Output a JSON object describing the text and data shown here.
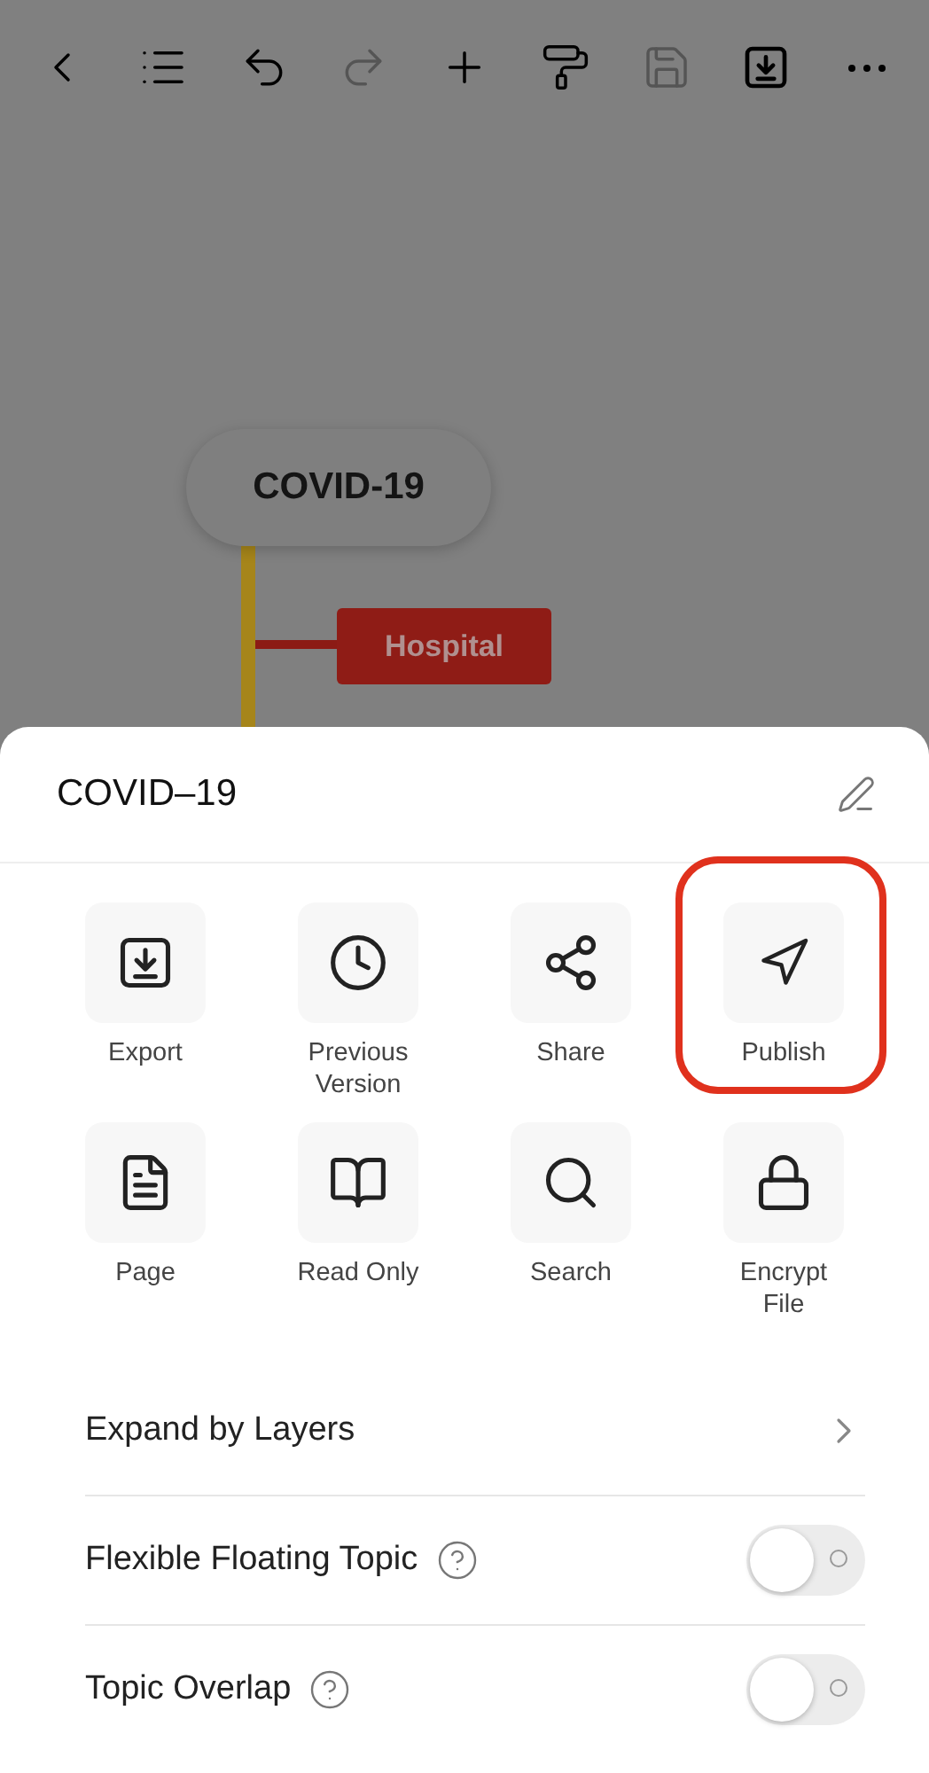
{
  "toolbar": [
    {
      "kind": "back",
      "disabled": false
    },
    {
      "kind": "outline",
      "disabled": false
    },
    {
      "kind": "undo",
      "disabled": false
    },
    {
      "kind": "redo",
      "disabled": true
    },
    {
      "kind": "add",
      "disabled": false
    },
    {
      "kind": "format",
      "disabled": false
    },
    {
      "kind": "save",
      "disabled": true
    },
    {
      "kind": "download",
      "disabled": false
    },
    {
      "kind": "more",
      "disabled": false
    }
  ],
  "mind_map": {
    "central_topic": "COVID-19",
    "topics": [
      {
        "label": "Hospital"
      }
    ]
  },
  "sheet": {
    "title": "COVID–19",
    "actions": [
      {
        "kind": "export",
        "label": "Export",
        "highlighted": false
      },
      {
        "kind": "history",
        "label": "Previous Version",
        "highlighted": false
      },
      {
        "kind": "share",
        "label": "Share",
        "highlighted": false
      },
      {
        "kind": "publish",
        "label": "Publish",
        "highlighted": true
      },
      {
        "kind": "page",
        "label": "Page",
        "highlighted": false
      },
      {
        "kind": "read",
        "label": "Read Only",
        "highlighted": false
      },
      {
        "kind": "search",
        "label": "Search",
        "highlighted": false
      },
      {
        "kind": "encrypt",
        "label": "Encrypt File",
        "highlighted": false
      }
    ],
    "settings": [
      {
        "kind": "link",
        "label": "Expand by Layers"
      },
      {
        "kind": "toggle",
        "label": "Flexible Floating Topic",
        "help": true,
        "on": false
      },
      {
        "kind": "toggle",
        "label": "Topic Overlap",
        "help": true,
        "on": false
      }
    ]
  }
}
